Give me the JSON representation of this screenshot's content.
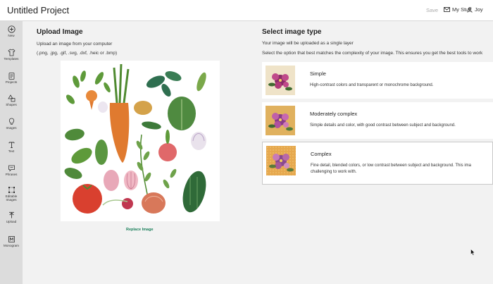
{
  "header": {
    "title": "Untitled Project",
    "save_label": "Save",
    "mystuff_label": "My Stuff",
    "user_label": "Joy"
  },
  "sidebar": {
    "items": [
      {
        "label": "New",
        "icon": "plus-circle-icon"
      },
      {
        "label": "Templates",
        "icon": "shirt-icon"
      },
      {
        "label": "Projects",
        "icon": "clipboard-icon"
      },
      {
        "label": "Shapes",
        "icon": "shapes-icon"
      },
      {
        "label": "Images",
        "icon": "lightbulb-icon"
      },
      {
        "label": "Text",
        "icon": "text-icon"
      },
      {
        "label": "Phrases",
        "icon": "speech-bubble-icon"
      },
      {
        "label": "Editable\nImages",
        "icon": "editable-images-icon"
      },
      {
        "label": "Upload",
        "icon": "upload-icon"
      },
      {
        "label": "Monogram",
        "icon": "monogram-icon"
      }
    ]
  },
  "upload": {
    "title": "Upload Image",
    "line1": "Upload an image from your computer",
    "line2": "(.png, .jpg, .gif, .svg, .dxf, .heic or .bmp)",
    "replace_label": "Replace Image"
  },
  "select": {
    "title": "Select image type",
    "line1": "Your image will be uploaded as a single layer",
    "line2": "Select the option that best matches the complexity of your image. This ensures you get the best tools to work",
    "options": [
      {
        "title": "Simple",
        "desc": "High-contrast colors and transparent or monochrome background.",
        "desc2": ""
      },
      {
        "title": "Moderately complex",
        "desc": "Simple details and color, with good contrast between subject and background.",
        "desc2": ""
      },
      {
        "title": "Complex",
        "desc": "Fine detail, blended colors, or low contrast between subject and background. This ima",
        "desc2": "challenging to work with."
      }
    ],
    "selected": "Complex"
  },
  "colors": {
    "accent": "#1a7f5a",
    "sidebar_bg": "#dcdcdc"
  }
}
